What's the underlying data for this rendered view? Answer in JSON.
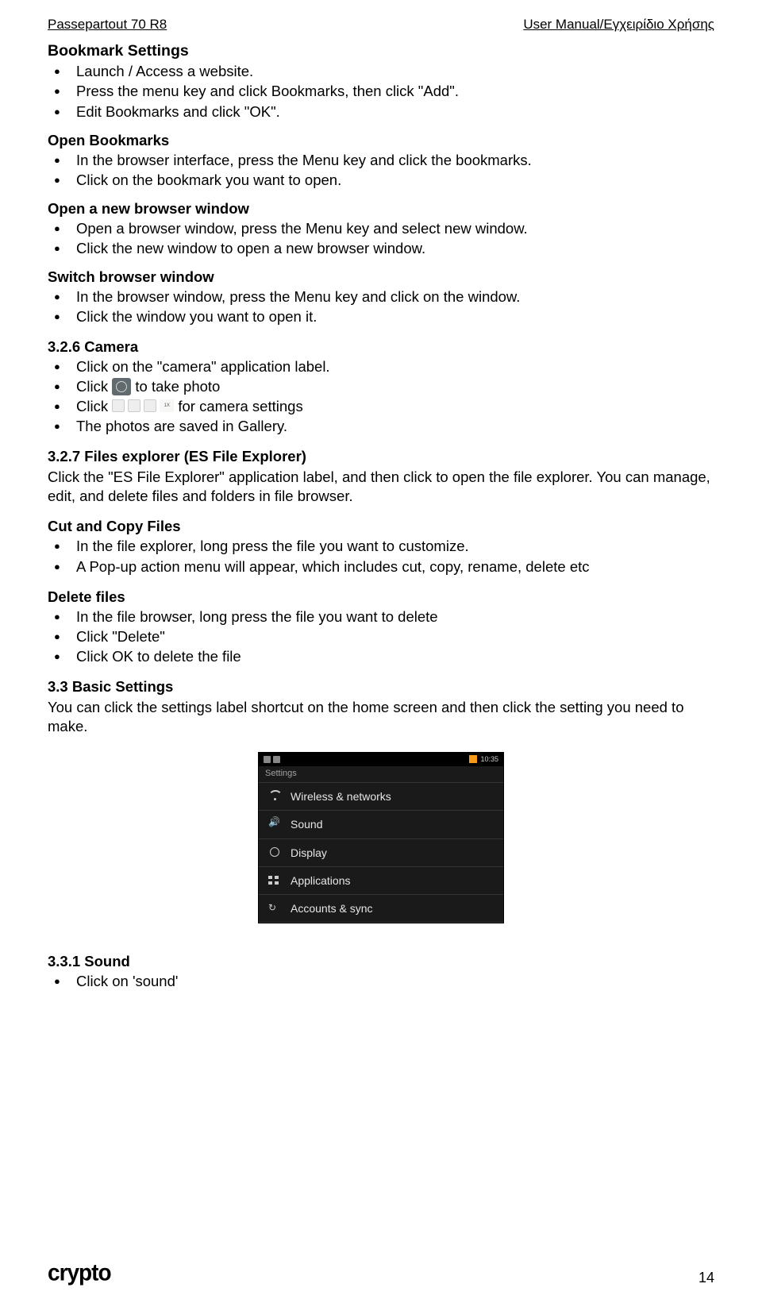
{
  "header": {
    "left": "Passepartout 70 R8",
    "right": "User Manual/Εγχειρίδιο Χρήσης"
  },
  "sections": {
    "bookmark_settings": {
      "heading": "Bookmark Settings",
      "items": [
        "Launch / Access a website.",
        "Press the menu key and click Bookmarks, then click \"Add\".",
        "Edit Bookmarks and click \"OK\"."
      ]
    },
    "open_bookmarks": {
      "heading": "Open Bookmarks",
      "items": [
        "In the browser interface, press the Menu key and click the bookmarks.",
        "Click on the bookmark you want to open."
      ]
    },
    "new_window": {
      "heading": "Open a new browser window",
      "items": [
        "Open a browser window, press the Menu key and select new window.",
        "Click the new window to open a new browser window."
      ]
    },
    "switch_window": {
      "heading": "Switch browser window",
      "items": [
        "In the browser window, press the Menu key and click on the window.",
        "Click the window you want to open it."
      ]
    },
    "camera": {
      "heading": "3.2.6 Camera",
      "item1": "Click on the \"camera\" application label.",
      "click_label": "Click ",
      "take_photo_suffix": " to take photo",
      "settings_suffix": " for camera settings",
      "item4": "The photos are saved in Gallery."
    },
    "files_explorer": {
      "heading": "3.2.7 Files explorer (ES File Explorer)",
      "para": "Click the \"ES File Explorer\" application label, and then click to open the file explorer. You can manage, edit, and delete files and folders in file browser."
    },
    "cut_copy": {
      "heading": "Cut and Copy Files",
      "items": [
        "In the file explorer, long press the file you want to customize.",
        "A Pop-up action menu will appear, which includes cut, copy, rename, delete etc"
      ]
    },
    "delete_files": {
      "heading": "Delete files",
      "items": [
        "In the file browser, long press the file you want to delete",
        "Click \"Delete\"",
        "Click OK to delete the file"
      ]
    },
    "basic_settings": {
      "heading": "3.3 Basic Settings",
      "para": "You can click the settings label shortcut on the home screen and then click the setting you need to make."
    },
    "sound": {
      "heading": "3.3.1 Sound",
      "items": [
        "Click on 'sound'"
      ]
    }
  },
  "settings_screenshot": {
    "time": "10:35",
    "title": "Settings",
    "rows": [
      "Wireless & networks",
      "Sound",
      "Display",
      "Applications",
      "Accounts & sync"
    ]
  },
  "footer": {
    "logo": "crypto",
    "page": "14"
  }
}
